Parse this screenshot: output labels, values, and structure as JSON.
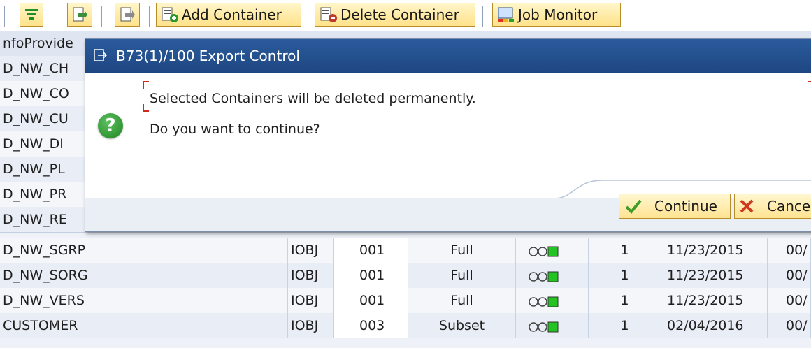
{
  "toolbar": {
    "add_label": "Add Container",
    "delete_label": "Delete Container",
    "jobmon_label": "Job Monitor"
  },
  "table": {
    "header_first": "nfoProvide",
    "rows_top": [
      "D_NW_CH",
      "D_NW_CO",
      "D_NW_CU",
      "D_NW_DI",
      "D_NW_PL",
      "D_NW_PR",
      "D_NW_RE"
    ],
    "rows": [
      {
        "name": "D_NW_SGRP",
        "type": "IOBJ",
        "num": "001",
        "mode": "Full",
        "count": "1",
        "date": "11/23/2015",
        "trail": "00/"
      },
      {
        "name": "D_NW_SORG",
        "type": "IOBJ",
        "num": "001",
        "mode": "Full",
        "count": "1",
        "date": "11/23/2015",
        "trail": "00/"
      },
      {
        "name": "D_NW_VERS",
        "type": "IOBJ",
        "num": "001",
        "mode": "Full",
        "count": "1",
        "date": "11/23/2015",
        "trail": "00/"
      },
      {
        "name": "CUSTOMER",
        "type": "IOBJ",
        "num": "003",
        "mode": "Subset",
        "count": "1",
        "date": "02/04/2016",
        "trail": "00/"
      }
    ]
  },
  "dialog": {
    "title": "B73(1)/100 Export Control",
    "line1": "Selected Containers will be deleted permanently.",
    "line2": "Do you want to continue?",
    "continue_label": "Continue",
    "cancel_label": "Cance"
  },
  "colors": {
    "title_bar": "#2b5b9c",
    "button_bg": "#ffe391",
    "status_green": "#22c322",
    "question_green": "#1d8420"
  }
}
